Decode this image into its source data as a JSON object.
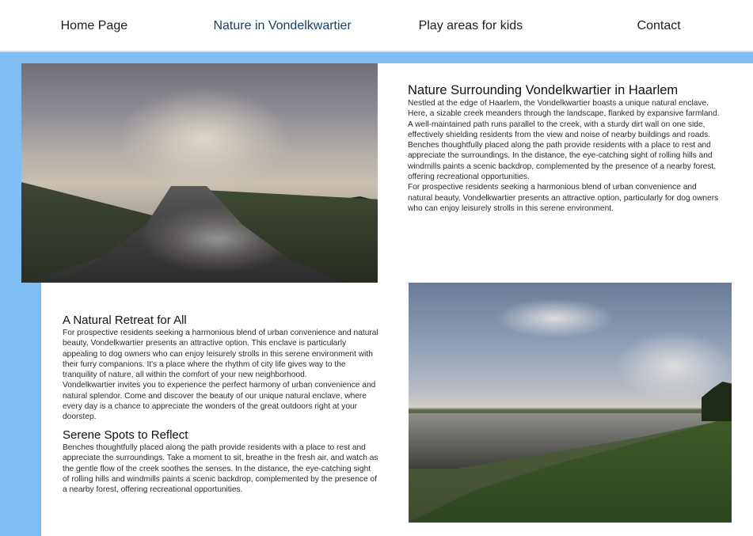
{
  "nav": {
    "items": [
      {
        "label": "Home Page",
        "active": false
      },
      {
        "label": "Nature in Vondelkwartier",
        "active": true
      },
      {
        "label": "Play areas for kids",
        "active": false
      },
      {
        "label": "Contact",
        "active": false
      }
    ]
  },
  "colors": {
    "accent_blue": "#7fbef5",
    "active_nav_text": "#1b3f66",
    "active_underline": "#2a5a9a"
  },
  "section1": {
    "heading": "Nature Surrounding Vondelkwartier in Haarlem",
    "p1": "Nestled at the edge of Haarlem, the Vondelkwartier boasts a unique natural enclave. Here, a sizable creek meanders through the landscape, flanked by expansive farmland. A well-maintained path runs parallel to the creek, with a sturdy dirt wall on one side, effectively shielding residents from the view and noise of nearby buildings and roads. Benches thoughtfully placed along the path provide residents with a place to rest and appreciate the surroundings. In the distance, the eye-catching sight of rolling hills and windmills paints a scenic backdrop, complemented by the presence of a nearby forest, offering recreational opportunities.",
    "p2": "For prospective residents seeking a harmonious blend of urban convenience and natural beauty, Vondelkwartier presents an attractive option, particularly for dog owners who can enjoy leisurely strolls in this serene environment."
  },
  "section2": {
    "heading": "A Natural Retreat for All",
    "p1": "For prospective residents seeking a harmonious blend of urban convenience and natural beauty, Vondelkwartier presents an attractive option. This enclave is particularly appealing to dog owners who can enjoy leisurely strolls in this serene environment with their furry companions. It's a place where the rhythm of city life gives way to the tranquility of nature, all within the comfort of your new neighborhood.",
    "p2": "Vondelkwartier invites you to experience the perfect harmony of urban convenience and natural splendor. Come and discover the beauty of our unique natural enclave, where every day is a chance to appreciate the wonders of the great outdoors right at your doorstep."
  },
  "section3": {
    "heading": "Serene Spots to Reflect",
    "p1": "Benches thoughtfully placed along the path provide residents with a place to rest and appreciate the surroundings. Take a moment to sit, breathe in the fresh air, and watch as the gentle flow of the creek soothes the senses. In the distance, the eye-catching sight of rolling hills and windmills paints a scenic backdrop, complemented by the presence of a nearby forest, offering recreational opportunities."
  }
}
